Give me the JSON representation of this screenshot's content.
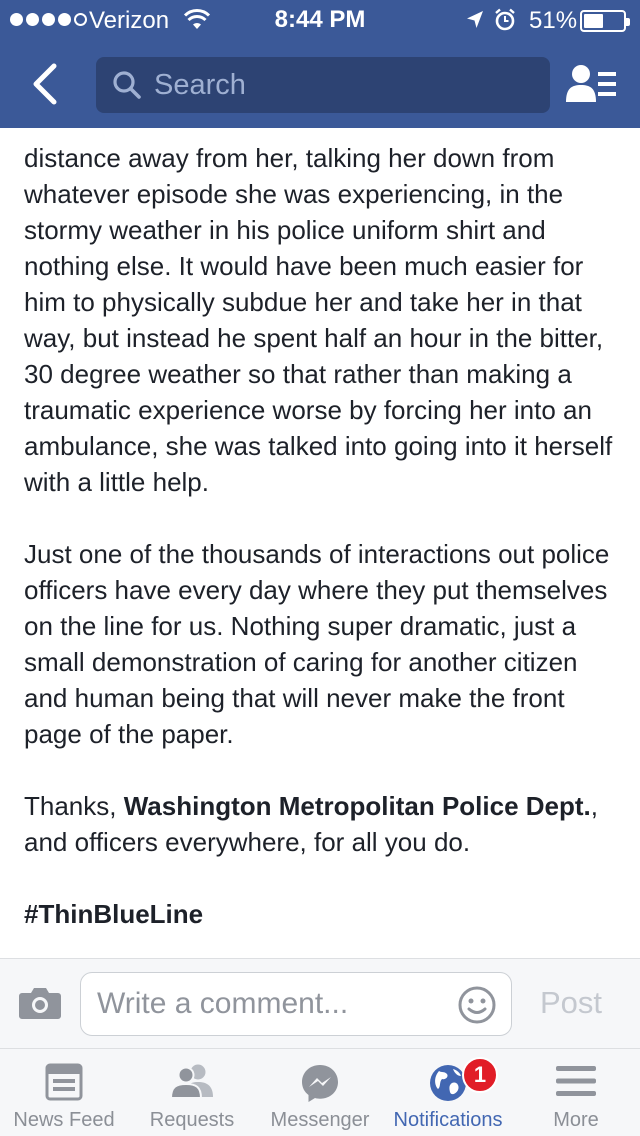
{
  "status_bar": {
    "carrier": "Verizon",
    "time": "8:44 PM",
    "battery_percent": "51%",
    "battery_level": 0.51,
    "signal_bars": 4,
    "icons": [
      "wifi-icon",
      "location-arrow-icon",
      "alarm-icon",
      "battery-icon"
    ]
  },
  "nav": {
    "search_placeholder": "Search",
    "icons": [
      "back-chevron-icon",
      "search-icon",
      "friends-list-icon"
    ]
  },
  "post": {
    "paragraph1": "distance away from her, talking her down from whatever episode she was experiencing, in the stormy weather in his police uniform shirt and nothing else. It would have been much easier for him to physically subdue her and take her in that way, but instead he spent half an hour in the bitter, 30 degree weather so that rather than making a traumatic experience worse by forcing her into an ambulance, she was talked into going into it herself with a little help.",
    "paragraph2": "Just one of the thousands of interactions out police officers have every day where they put themselves on the line for us. Nothing super dramatic, just a small demonstration of caring for another citizen and human being that will never make the front page of the paper.",
    "thanks_prefix": "Thanks, ",
    "mention": "Washington Metropolitan Police Dept.",
    "thanks_suffix": ", and officers everywhere, for all you do.",
    "hashtag": "#ThinBlueLine"
  },
  "comment": {
    "placeholder": "Write a comment...",
    "post_label": "Post",
    "icons": [
      "camera-icon",
      "emoji-icon"
    ]
  },
  "tabs": [
    {
      "label": "News Feed",
      "icon": "news-feed-icon",
      "active": false
    },
    {
      "label": "Requests",
      "icon": "friend-requests-icon",
      "active": false
    },
    {
      "label": "Messenger",
      "icon": "messenger-icon",
      "active": false
    },
    {
      "label": "Notifications",
      "icon": "globe-icon",
      "active": true,
      "badge": "1"
    },
    {
      "label": "More",
      "icon": "menu-icon",
      "active": false
    }
  ],
  "colors": {
    "brand": "#3b5998",
    "active_tab": "#4267b2",
    "badge": "#e11d27"
  }
}
